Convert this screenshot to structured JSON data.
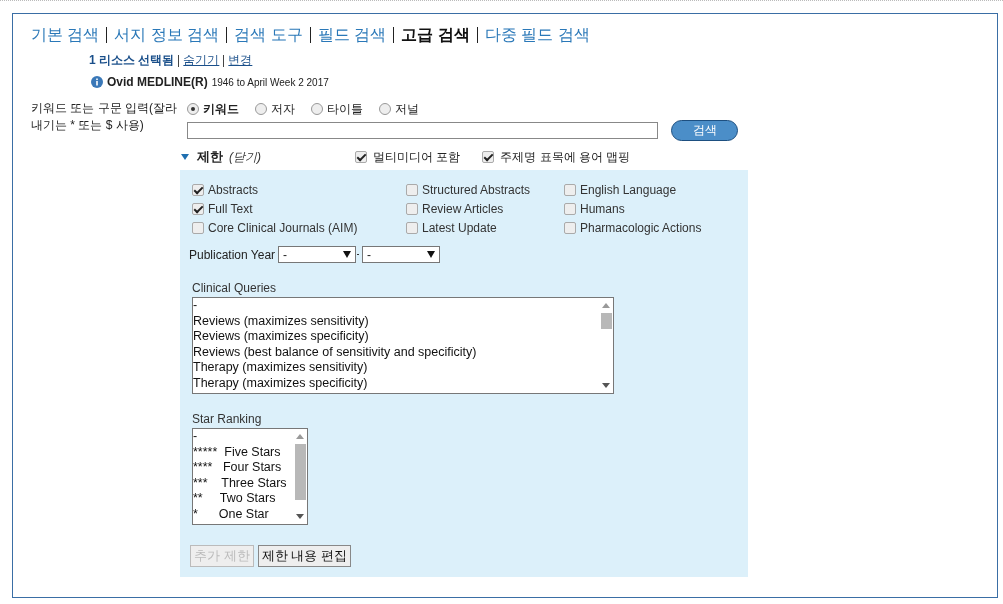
{
  "tabs": [
    {
      "label": "기본 검색",
      "selected": false
    },
    {
      "label": "서지 정보 검색",
      "selected": false
    },
    {
      "label": "검색 도구",
      "selected": false
    },
    {
      "label": "필드 검색",
      "selected": false
    },
    {
      "label": "고급 검색",
      "selected": true
    },
    {
      "label": "다중 필드 검색",
      "selected": false
    }
  ],
  "resources": {
    "count": "1 리소스 선택됨",
    "links": [
      "숨기기",
      "변경"
    ]
  },
  "database": {
    "name": "Ovid MEDLINE(R)",
    "coverage": "1946 to April Week 2 2017"
  },
  "search": {
    "label": "키워드 또는 구문 입력(잘라내기는 * 또는 $ 사용)",
    "button": "검색",
    "modes": [
      {
        "label": "키워드",
        "selected": true
      },
      {
        "label": "저자",
        "selected": false
      },
      {
        "label": "타이틀",
        "selected": false
      },
      {
        "label": "저널",
        "selected": false
      }
    ]
  },
  "limits": {
    "label": "제한",
    "toggle": "(닫기)",
    "expanded": true,
    "options": [
      {
        "label": "멀티미디어 포함",
        "checked": true
      },
      {
        "label": "주제명 표목에 용어 맵핑",
        "checked": true
      }
    ]
  },
  "limit_checkboxes": [
    {
      "label": "Abstracts",
      "checked": true
    },
    {
      "label": "Structured Abstracts",
      "checked": false
    },
    {
      "label": "English Language",
      "checked": false
    },
    {
      "label": "Full Text",
      "checked": true
    },
    {
      "label": "Review Articles",
      "checked": false
    },
    {
      "label": "Humans",
      "checked": false
    },
    {
      "label": "Core Clinical Journals (AIM)",
      "checked": false
    },
    {
      "label": "Latest Update",
      "checked": false
    },
    {
      "label": "Pharmacologic Actions",
      "checked": false
    }
  ],
  "publication_year": {
    "label": "Publication Year",
    "from": "-",
    "to": "-"
  },
  "clinical_queries": {
    "label": "Clinical Queries",
    "items": [
      "-",
      "Reviews (maximizes sensitivity)",
      "Reviews (maximizes specificity)",
      "Reviews (best balance of sensitivity and specificity)",
      "Therapy (maximizes sensitivity)",
      "Therapy (maximizes specificity)"
    ]
  },
  "star_ranking": {
    "label": "Star Ranking",
    "items": [
      "-",
      "*****  Five Stars",
      "****   Four Stars",
      "***    Three Stars",
      "**     Two Stars",
      "*      One Star"
    ]
  },
  "buttons": [
    {
      "label": "추가 제한",
      "disabled": true
    },
    {
      "label": "제한 내용 편집",
      "disabled": false
    }
  ]
}
